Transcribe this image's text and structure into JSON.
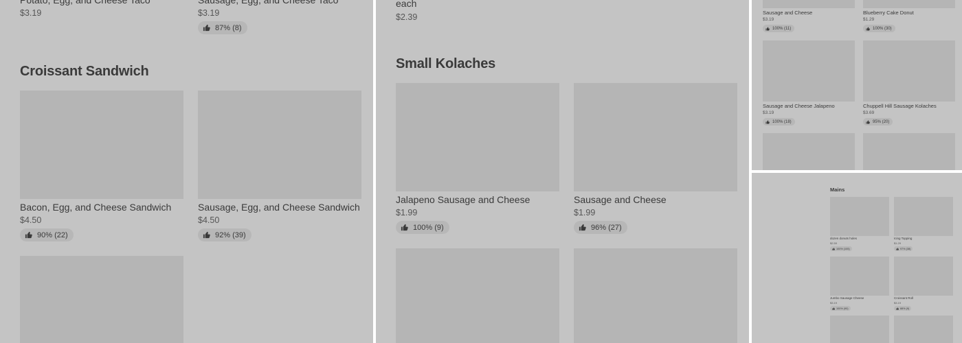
{
  "panel_a": {
    "top_items": [
      {
        "name": "Potato, Egg, and Cheese Taco",
        "price": "$3.19"
      },
      {
        "name": "Sausage, Egg, and Cheese Taco",
        "price": "$3.19",
        "rating": "87% (8)"
      }
    ],
    "section_title": "Croissant Sandwich",
    "items": [
      {
        "name": "Bacon, Egg, and Cheese Sandwich",
        "price": "$4.50",
        "rating": "90% (22)"
      },
      {
        "name": "Sausage, Egg, and Cheese Sandwich",
        "price": "$4.50",
        "rating": "92% (39)"
      }
    ]
  },
  "panel_b": {
    "top_item": {
      "name": "each",
      "price": "$2.39"
    },
    "section_title": "Small Kolaches",
    "items": [
      {
        "name": "Jalapeno Sausage and Cheese",
        "price": "$1.99",
        "rating": "100% (9)"
      },
      {
        "name": "Sausage and Cheese",
        "price": "$1.99",
        "rating": "96% (27)"
      }
    ]
  },
  "panel_c": {
    "items": [
      {
        "name": "Sausage and Cheese",
        "price": "$3.19",
        "rating": "100% (11)"
      },
      {
        "name": "Blueberry Cake Donut",
        "price": "$1.29",
        "rating": "100% (30)"
      },
      {
        "name": "Sausage and Cheese Jalapeno",
        "price": "$3.19",
        "rating": "100% (18)"
      },
      {
        "name": "Chuppell Hill Sausage Kolaches",
        "price": "$3.69",
        "rating": "95% (20)"
      }
    ]
  },
  "panel_d": {
    "section_title": "Mains",
    "items": [
      {
        "name": "dozen donuts holes",
        "price": "$2.59",
        "rating": "100% (105)"
      },
      {
        "name": "Icing Topping",
        "price": "$1.29",
        "rating": "97% (38)"
      },
      {
        "name": "Jumbo Sausage Cheese",
        "price": "$3.19",
        "rating": "100% (90)"
      },
      {
        "name": "Croissant Roll",
        "price": "$3.19",
        "rating": "88% (9)"
      }
    ]
  },
  "icons": {
    "rating": "thumbs-up-icon"
  },
  "colors": {
    "overlay": "#c4c4c4",
    "image_placeholder": "#b5b5b5",
    "pill": "#b7b7b7",
    "divider": "#ffffff"
  }
}
